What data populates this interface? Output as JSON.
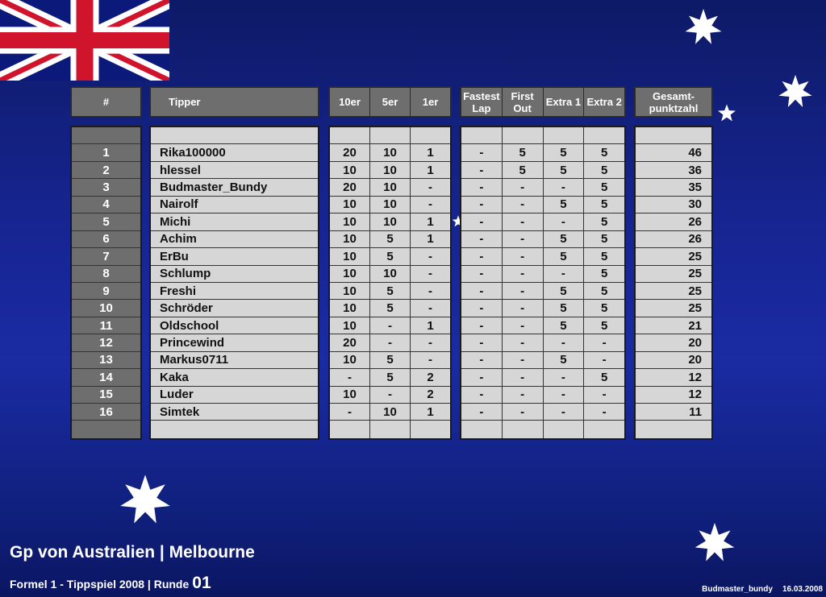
{
  "colors": {
    "background": "#16248f",
    "header": "#6e6e6e",
    "cell": "#d6d6d6",
    "star": "#ffffff"
  },
  "icons": [
    "union-jack-flag",
    "star-icon"
  ],
  "headers": {
    "rank": "#",
    "tipper": "Tipper",
    "ten": "10er",
    "five": "5er",
    "one": "1er",
    "fastest_lap": "Fastest Lap",
    "first_out": "First Out",
    "extra1": "Extra 1",
    "extra2": "Extra 2",
    "total": "Gesamt-punktzahl"
  },
  "rows": [
    {
      "rank": "1",
      "name": "Rika100000",
      "ten": "20",
      "five": "10",
      "one": "1",
      "fl": "-",
      "fo": "5",
      "e1": "5",
      "e2": "5",
      "total": "46"
    },
    {
      "rank": "2",
      "name": "hlessel",
      "ten": "10",
      "five": "10",
      "one": "1",
      "fl": "-",
      "fo": "5",
      "e1": "5",
      "e2": "5",
      "total": "36"
    },
    {
      "rank": "3",
      "name": "Budmaster_Bundy",
      "ten": "20",
      "five": "10",
      "one": "-",
      "fl": "-",
      "fo": "-",
      "e1": "-",
      "e2": "5",
      "total": "35"
    },
    {
      "rank": "4",
      "name": "Nairolf",
      "ten": "10",
      "five": "10",
      "one": "-",
      "fl": "-",
      "fo": "-",
      "e1": "5",
      "e2": "5",
      "total": "30"
    },
    {
      "rank": "5",
      "name": "Michi",
      "ten": "10",
      "five": "10",
      "one": "1",
      "fl": "-",
      "fo": "-",
      "e1": "-",
      "e2": "5",
      "total": "26"
    },
    {
      "rank": "6",
      "name": "Achim",
      "ten": "10",
      "five": "5",
      "one": "1",
      "fl": "-",
      "fo": "-",
      "e1": "5",
      "e2": "5",
      "total": "26"
    },
    {
      "rank": "7",
      "name": "ErBu",
      "ten": "10",
      "five": "5",
      "one": "-",
      "fl": "-",
      "fo": "-",
      "e1": "5",
      "e2": "5",
      "total": "25"
    },
    {
      "rank": "8",
      "name": "Schlump",
      "ten": "10",
      "five": "10",
      "one": "-",
      "fl": "-",
      "fo": "-",
      "e1": "-",
      "e2": "5",
      "total": "25"
    },
    {
      "rank": "9",
      "name": "Freshi",
      "ten": "10",
      "five": "5",
      "one": "-",
      "fl": "-",
      "fo": "-",
      "e1": "5",
      "e2": "5",
      "total": "25"
    },
    {
      "rank": "10",
      "name": "Schröder",
      "ten": "10",
      "five": "5",
      "one": "-",
      "fl": "-",
      "fo": "-",
      "e1": "5",
      "e2": "5",
      "total": "25"
    },
    {
      "rank": "11",
      "name": "Oldschool",
      "ten": "10",
      "five": "-",
      "one": "1",
      "fl": "-",
      "fo": "-",
      "e1": "5",
      "e2": "5",
      "total": "21"
    },
    {
      "rank": "12",
      "name": "Princewind",
      "ten": "20",
      "five": "-",
      "one": "-",
      "fl": "-",
      "fo": "-",
      "e1": "-",
      "e2": "-",
      "total": "20"
    },
    {
      "rank": "13",
      "name": "Markus0711",
      "ten": "10",
      "five": "5",
      "one": "-",
      "fl": "-",
      "fo": "-",
      "e1": "5",
      "e2": "-",
      "total": "20"
    },
    {
      "rank": "14",
      "name": "Kaka",
      "ten": "-",
      "five": "5",
      "one": "2",
      "fl": "-",
      "fo": "-",
      "e1": "-",
      "e2": "5",
      "total": "12"
    },
    {
      "rank": "15",
      "name": "Luder",
      "ten": "10",
      "five": "-",
      "one": "2",
      "fl": "-",
      "fo": "-",
      "e1": "-",
      "e2": "-",
      "total": "12"
    },
    {
      "rank": "16",
      "name": "Simtek",
      "ten": "-",
      "five": "10",
      "one": "1",
      "fl": "-",
      "fo": "-",
      "e1": "-",
      "e2": "-",
      "total": "11"
    }
  ],
  "footer": {
    "title": "Gp von Australien | Melbourne",
    "subtitle": "Formel 1 - Tippspiel 2008 | Runde",
    "round": "01",
    "author": "Budmaster_bundy",
    "date": "16.03.2008"
  }
}
